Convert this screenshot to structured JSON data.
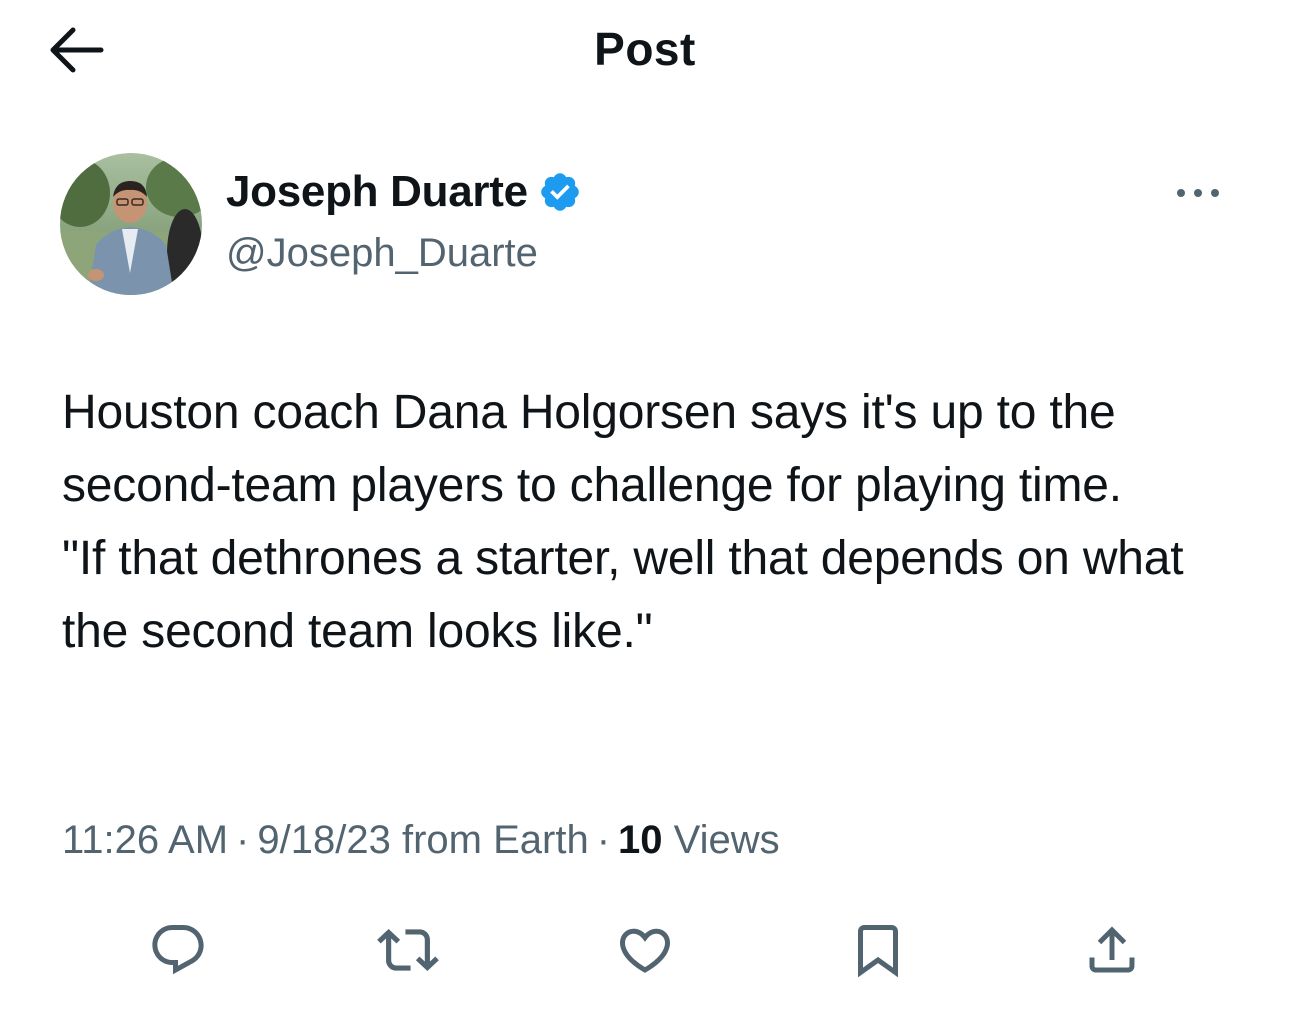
{
  "header": {
    "title": "Post",
    "back_icon": "arrow-left-icon"
  },
  "author": {
    "display_name": "Joseph Duarte",
    "handle": "@Joseph_Duarte",
    "verified": true,
    "verified_color": "#1d9bf0"
  },
  "post": {
    "text": "Houston coach Dana Holgorsen says it's up to the second-team players to challenge for playing time.\n\"If that dethrones a starter, well that depends on what the second team looks like.\""
  },
  "meta": {
    "time": "11:26 AM",
    "separator": "·",
    "date": "9/18/23",
    "source": "from Earth",
    "views_count": "10",
    "views_label": "Views"
  },
  "actions": [
    {
      "name": "reply",
      "icon": "reply-icon"
    },
    {
      "name": "repost",
      "icon": "repost-icon"
    },
    {
      "name": "like",
      "icon": "heart-icon"
    },
    {
      "name": "bookmark",
      "icon": "bookmark-icon"
    },
    {
      "name": "share",
      "icon": "share-icon"
    }
  ],
  "colors": {
    "text_primary": "#0f1419",
    "text_secondary": "#536471",
    "icon_gray": "#536471"
  }
}
